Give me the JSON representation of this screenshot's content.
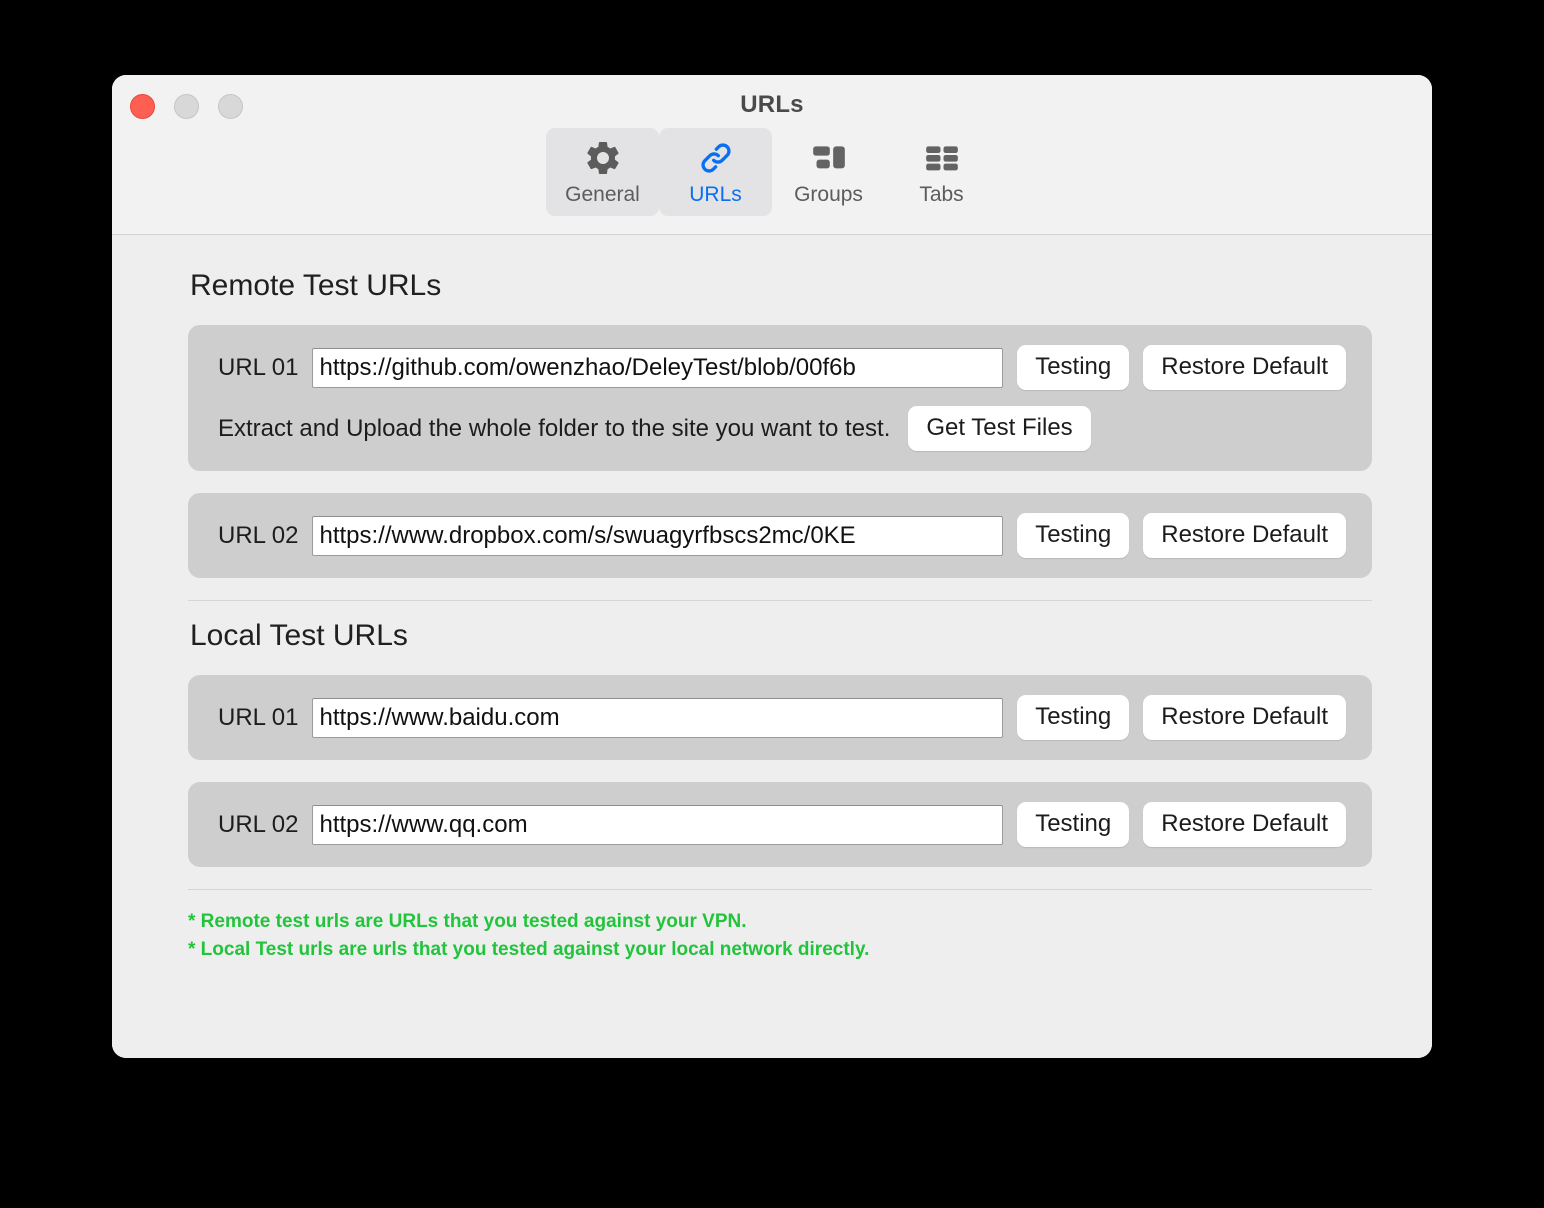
{
  "window": {
    "title": "URLs",
    "traffic_lights": {
      "close": "close-button",
      "minimize": "minimize-button",
      "zoom": "zoom-button"
    }
  },
  "toolbar": {
    "tabs": [
      {
        "id": "general",
        "label": "General",
        "icon": "gear-icon",
        "active": false,
        "highlighted": true
      },
      {
        "id": "urls",
        "label": "URLs",
        "icon": "link-icon",
        "active": true,
        "highlighted": true
      },
      {
        "id": "groups",
        "label": "Groups",
        "icon": "groups-icon",
        "active": false,
        "highlighted": false
      },
      {
        "id": "tabs",
        "label": "Tabs",
        "icon": "tabs-grid-icon",
        "active": false,
        "highlighted": false
      }
    ]
  },
  "sections": {
    "remote": {
      "title": "Remote Test URLs",
      "rows": [
        {
          "label": "URL 01",
          "value": "https://github.com/owenzhao/DeleyTest/blob/00f6b",
          "testing_label": "Testing",
          "restore_label": "Restore Default",
          "hint_text": "Extract and Upload the whole folder to the site you want to test.",
          "hint_button": "Get Test Files"
        },
        {
          "label": "URL 02",
          "value": "https://www.dropbox.com/s/swuagyrfbscs2mc/0KE",
          "testing_label": "Testing",
          "restore_label": "Restore Default"
        }
      ]
    },
    "local": {
      "title": "Local Test URLs",
      "rows": [
        {
          "label": "URL 01",
          "value": "https://www.baidu.com",
          "testing_label": "Testing",
          "restore_label": "Restore Default"
        },
        {
          "label": "URL 02",
          "value": "https://www.qq.com",
          "testing_label": "Testing",
          "restore_label": "Restore Default"
        }
      ]
    }
  },
  "footer": {
    "notes": [
      "* Remote test urls are URLs that you tested against your VPN.",
      "* Local Test urls are urls that you tested against your local network directly."
    ]
  },
  "colors": {
    "accent": "#0a6ff0",
    "note_green": "#22c43c",
    "close_red": "#ff5f52",
    "window_bg": "#eeeeef",
    "row_bg": "#cececf"
  }
}
